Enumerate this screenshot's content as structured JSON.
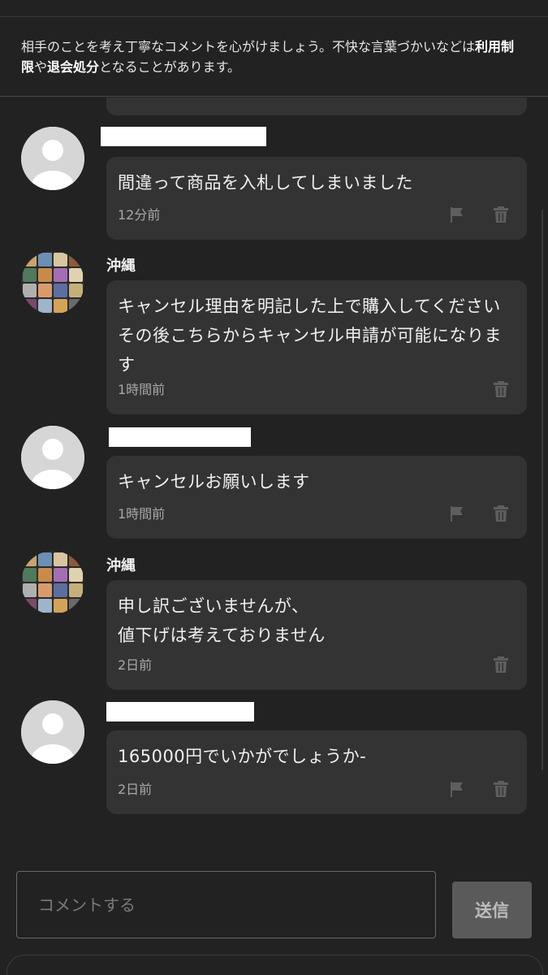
{
  "notice": {
    "text_before": "相手のことを考え丁寧なコメントを心がけましょう。不快な言葉づかいなどは",
    "bold_1": "利用制限",
    "text_mid": "や",
    "bold_2": "退会処分",
    "text_after": "となることがあります。"
  },
  "comments": [
    {
      "author": "",
      "author_redacted": true,
      "avatar": "default-avatar",
      "text": "間違って商品を入札してしまいました",
      "time": "12分前",
      "actions": [
        "flag-icon",
        "trash-icon"
      ]
    },
    {
      "author": "沖縄",
      "author_redacted": false,
      "avatar": "seller-photo-avatar",
      "text": "キャンセル理由を明記した上で購入してください\nその後こちらからキャンセル申請が可能になります",
      "time": "1時間前",
      "actions": [
        "trash-icon"
      ]
    },
    {
      "author": "",
      "author_redacted": true,
      "avatar": "default-avatar",
      "text": "キャンセルお願いします",
      "time": "1時間前",
      "actions": [
        "flag-icon",
        "trash-icon"
      ]
    },
    {
      "author": "沖縄",
      "author_redacted": false,
      "avatar": "seller-photo-avatar",
      "text": "申し訳ございませんが、\n値下げは考えておりません",
      "time": "2日前",
      "actions": [
        "trash-icon"
      ]
    },
    {
      "author": "",
      "author_redacted": true,
      "avatar": "default-avatar",
      "text": "165000円でいかがでしょうか-",
      "time": "2日前",
      "actions": [
        "flag-icon",
        "trash-icon"
      ]
    }
  ],
  "composer": {
    "placeholder": "コメントする",
    "send_label": "送信"
  },
  "colors": {
    "background": "#222222",
    "bubble": "#333333",
    "send_button": "#5a5a5a"
  }
}
